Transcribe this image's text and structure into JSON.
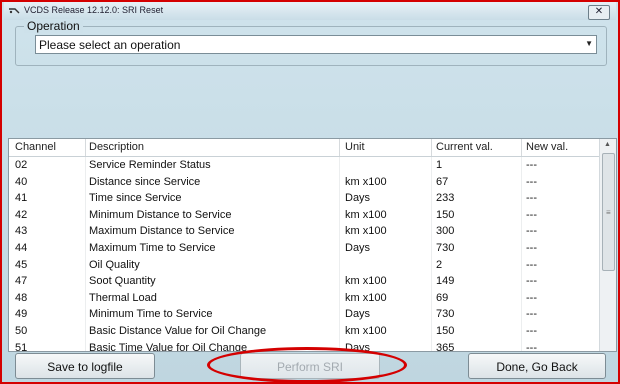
{
  "window": {
    "title": "VCDS Release 12.12.0:  SRI Reset",
    "close_glyph": "✕"
  },
  "operation": {
    "group_label": "Operation",
    "selected": "Please select an operation"
  },
  "table": {
    "columns": [
      "Channel",
      "Description",
      "Unit",
      "Current val.",
      "New val."
    ],
    "rows": [
      {
        "channel": "02",
        "description": "Service Reminder Status",
        "unit": "",
        "current": "1",
        "new": "---"
      },
      {
        "channel": "40",
        "description": "Distance since Service",
        "unit": "km x100",
        "current": "67",
        "new": "---"
      },
      {
        "channel": "41",
        "description": "Time since Service",
        "unit": "Days",
        "current": "233",
        "new": "---"
      },
      {
        "channel": "42",
        "description": "Minimum Distance to Service",
        "unit": "km x100",
        "current": "150",
        "new": "---"
      },
      {
        "channel": "43",
        "description": "Maximum Distance to Service",
        "unit": "km x100",
        "current": "300",
        "new": "---"
      },
      {
        "channel": "44",
        "description": "Maximum Time to Service",
        "unit": "Days",
        "current": "730",
        "new": "---"
      },
      {
        "channel": "45",
        "description": "Oil Quality",
        "unit": "",
        "current": "2",
        "new": "---"
      },
      {
        "channel": "47",
        "description": "Soot Quantity",
        "unit": "km x100",
        "current": "149",
        "new": "---"
      },
      {
        "channel": "48",
        "description": "Thermal Load",
        "unit": "km x100",
        "current": "69",
        "new": "---"
      },
      {
        "channel": "49",
        "description": "Minimum Time to Service",
        "unit": "Days",
        "current": "730",
        "new": "---"
      },
      {
        "channel": "50",
        "description": "Basic Distance Value for Oil Change",
        "unit": "km x100",
        "current": "150",
        "new": "---"
      },
      {
        "channel": "51",
        "description": "Basic Time Value for Oil Change",
        "unit": "Days",
        "current": "365",
        "new": "---"
      }
    ]
  },
  "buttons": {
    "save": "Save to logfile",
    "perform": "Perform SRI",
    "done": "Done, Go Back"
  },
  "colors": {
    "highlight": "#d40000"
  }
}
